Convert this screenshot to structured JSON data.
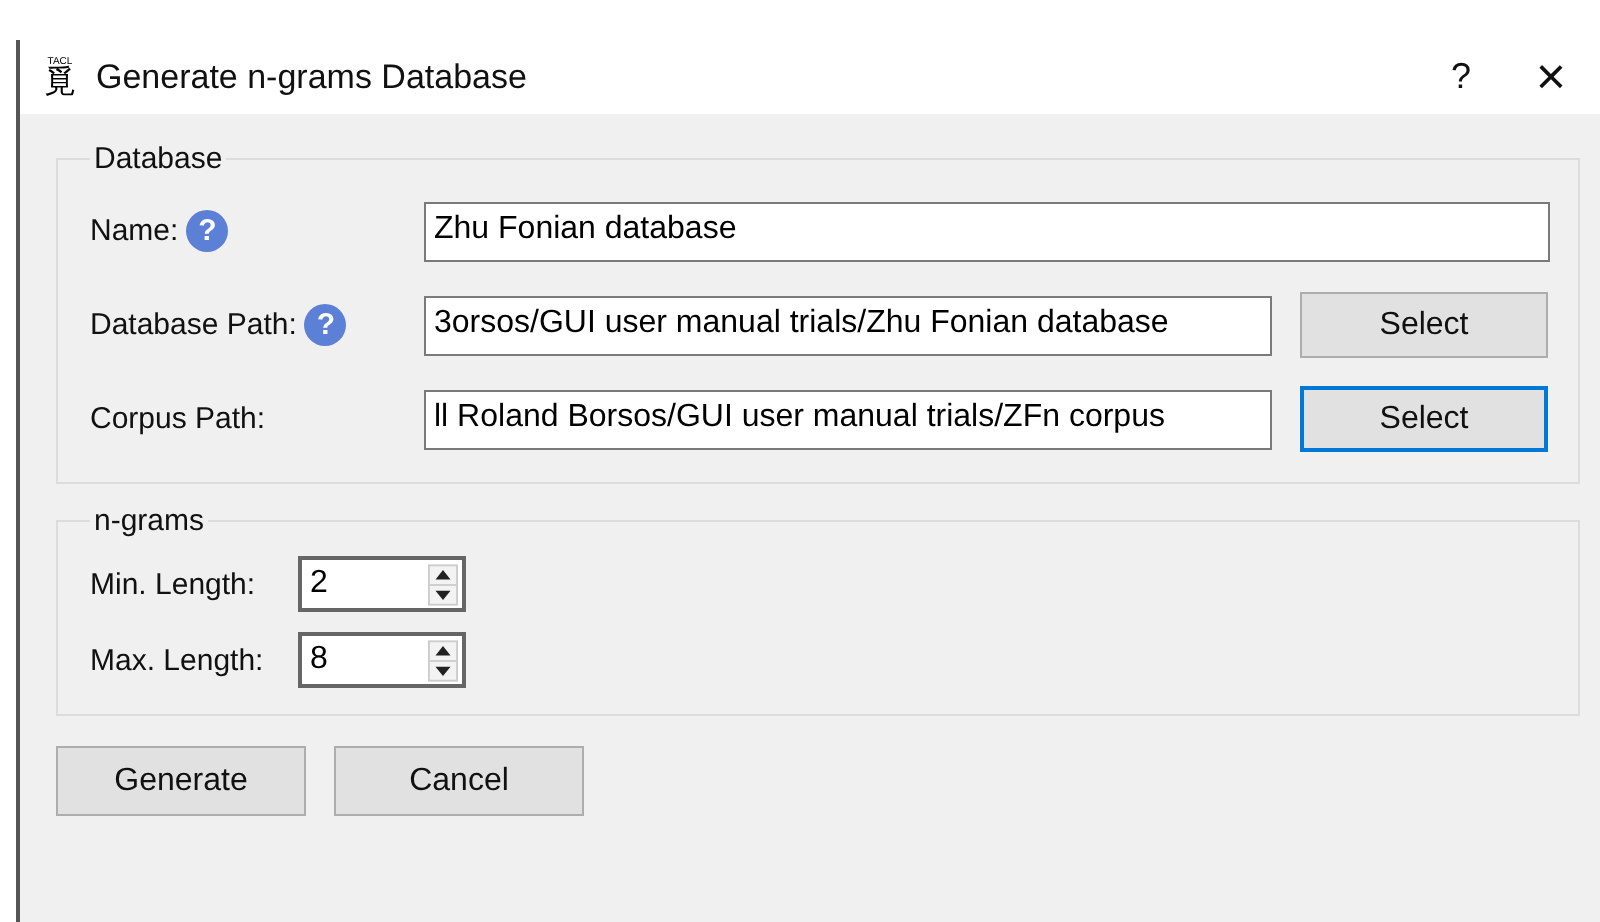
{
  "window": {
    "title": "Generate n-grams Database",
    "logo": {
      "mark": "TACL",
      "glyph": "覓"
    },
    "help": "?",
    "close": "×"
  },
  "database": {
    "legend": "Database",
    "fields": [
      {
        "label": "Name:",
        "help": "?",
        "value": "Zhu Fonian database"
      },
      {
        "label": "Database Path:",
        "help": "?",
        "value": "3orsos/GUI user manual trials/Zhu Fonian database",
        "button": {
          "label": "Select",
          "focused": false
        }
      },
      {
        "label": "Corpus Path:",
        "value": "ll Roland Borsos/GUI user manual trials/ZFn corpus",
        "button": {
          "label": "Select",
          "focused": true
        }
      }
    ]
  },
  "ngrams": {
    "legend": "n-grams",
    "spinners": [
      {
        "label": "Min. Length:",
        "value": "2"
      },
      {
        "label": "Max. Length:",
        "value": "8"
      }
    ]
  },
  "buttons": [
    "Generate",
    "Cancel"
  ]
}
